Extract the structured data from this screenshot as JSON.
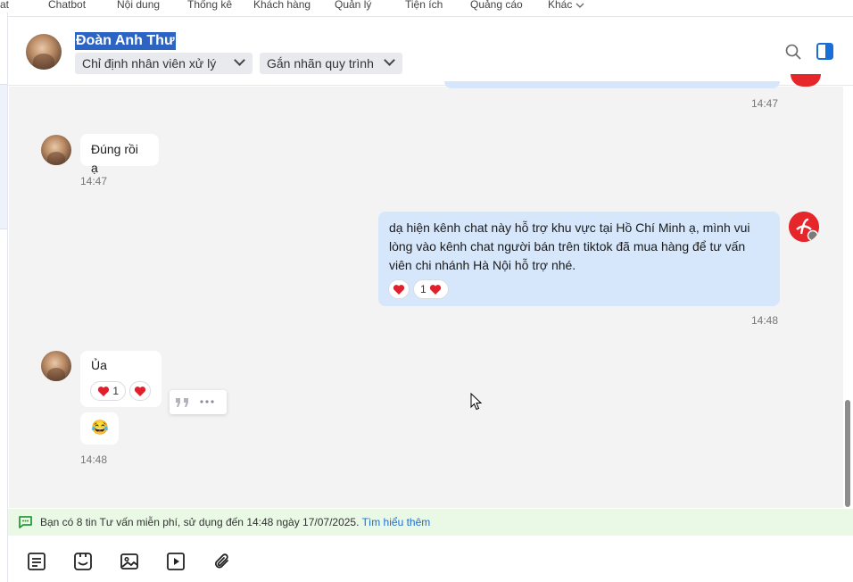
{
  "topnav": {
    "items": [
      "at",
      "Chatbot",
      "Nội dung",
      "Thống kê",
      "Khách hàng",
      "Quản lý",
      "Tiện ích",
      "Quảng cáo",
      "Khác"
    ]
  },
  "header": {
    "contact_name": "Đoàn Anh Thư",
    "assign_label": "Chỉ định nhân viên xử lý",
    "tag_label": "Gắn nhãn quy trình",
    "accent_color": "#2c64c3"
  },
  "messages": {
    "m1_time": "14:47",
    "m2_text": "Đúng rồi ạ",
    "m2_time": "14:47",
    "m3_text": "dạ hiện kênh chat này hỗ trợ khu vực tại Hồ Chí Minh ạ, mình vui lòng vào kênh chat người bán trên tiktok đã mua hàng để tư vấn viên chi nhánh Hà Nội hỗ trợ nhé.",
    "m3_reaction_count": "1",
    "m3_time": "14:48",
    "m4_text": "Ủa",
    "m4_reaction_count": "1",
    "m5_text": "😂",
    "m5_time": "14:48"
  },
  "infobar": {
    "message": "Bạn có 8 tin Tư vấn miễn phí, sử dụng đến 14:48 ngày 17/07/2025.",
    "link": "Tìm hiểu thêm",
    "bg_color": "#e9f9e5",
    "link_color": "#1a6ed8"
  },
  "toolbar": {
    "icons": [
      "template-icon",
      "sticker-icon",
      "image-icon",
      "video-icon",
      "attachment-icon"
    ]
  }
}
